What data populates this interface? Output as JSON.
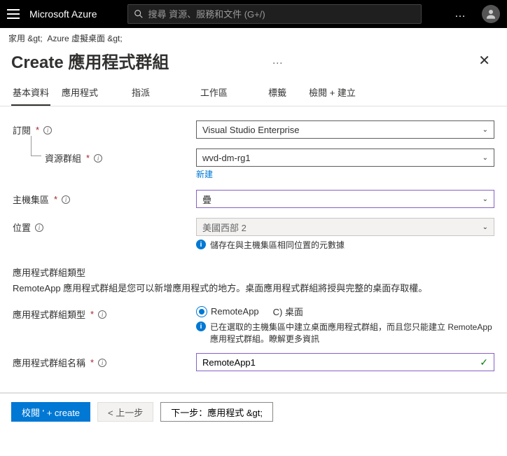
{
  "topbar": {
    "brand": "Microsoft Azure",
    "search_placeholder": "搜尋 資源、服務和文件 (G+/)"
  },
  "breadcrumb": {
    "items": [
      "家用 &gt;",
      "Azure 虛擬桌面 &gt;"
    ]
  },
  "page": {
    "title": "Create 應用程式群組"
  },
  "tabs": [
    {
      "label": "基本資料",
      "active": true
    },
    {
      "label": "應用程式",
      "active": false
    },
    {
      "label": "指派",
      "active": false
    },
    {
      "label": "工作區",
      "active": false
    },
    {
      "label": "標籤",
      "active": false
    },
    {
      "label": "檢閱 + 建立",
      "active": false
    }
  ],
  "form": {
    "subscription_label": "訂閱",
    "subscription_value": "Visual Studio Enterprise",
    "resource_group_label": "資源群組",
    "resource_group_value": "wvd-dm-rg1",
    "create_new": "新建",
    "host_pool_label": "主機集區",
    "host_pool_value": "疊",
    "location_label": "位置",
    "location_value": "美國西部 2",
    "location_info": "儲存在與主機集區相同位置的元數據",
    "section_title": "應用程式群組類型",
    "section_desc": "RemoteApp 應用程式群組是您可以新增應用程式的地方。桌面應用程式群組將授與完整的桌面存取權。",
    "type_label": "應用程式群組類型",
    "radio_remoteapp": "RemoteApp",
    "radio_desktop": "C) 桌面",
    "type_info": "已在選取的主機集區中建立桌面應用程式群組，而且您只能建立 RemoteApp 應用程式群組。瞭解更多資訊",
    "name_label": "應用程式群組名稱",
    "name_value": "RemoteApp1"
  },
  "footer": {
    "review": "校閱 ' + create",
    "prev": "< 上一步",
    "next": "下一步：應用程式 &gt;"
  }
}
